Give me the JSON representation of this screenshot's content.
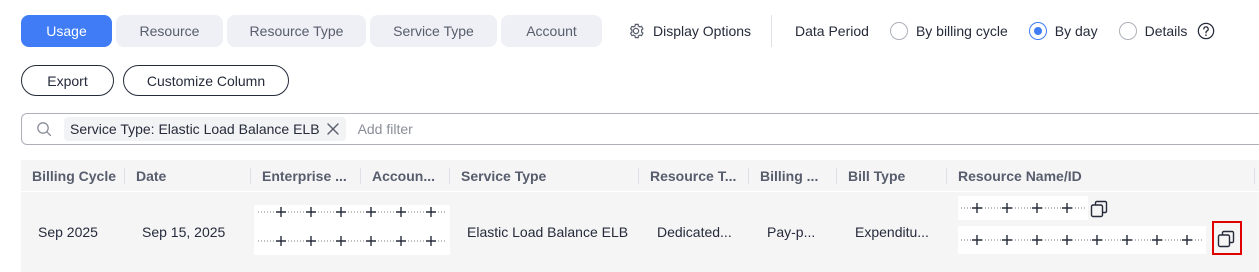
{
  "tabs": [
    {
      "label": "Usage",
      "active": true
    },
    {
      "label": "Resource",
      "active": false
    },
    {
      "label": "Resource Type",
      "active": false
    },
    {
      "label": "Service Type",
      "active": false
    },
    {
      "label": "Account",
      "active": false
    }
  ],
  "display_options": {
    "label": "Display Options",
    "icon": "gear-icon"
  },
  "data_period": {
    "label": "Data Period",
    "options": [
      {
        "label": "By billing cycle",
        "checked": false
      },
      {
        "label": "By day",
        "checked": true
      },
      {
        "label": "Details",
        "checked": false
      }
    ]
  },
  "toolbar": {
    "export_label": "Export",
    "customize_label": "Customize Column"
  },
  "filter": {
    "chip_label": "Service Type: Elastic Load Balance ELB",
    "add_filter_placeholder": "Add filter"
  },
  "table": {
    "columns": [
      "Billing Cycle",
      "Date",
      "Enterprise ...",
      "Accoun...",
      "Service Type",
      "Resource T...",
      "Billing ...",
      "Bill Type",
      "Resource Name/ID"
    ],
    "rows": [
      {
        "billing_cycle": "Sep 2025",
        "date": "Sep 15, 2025",
        "service_type": "Elastic Load Balance ELB",
        "resource_type": "Dedicated...",
        "billing_mode": "Pay-p...",
        "bill_type": "Expenditu..."
      }
    ]
  },
  "colors": {
    "accent": "#3f7cf6",
    "highlight": "#e00000",
    "header_bg": "#f5f5f6"
  }
}
